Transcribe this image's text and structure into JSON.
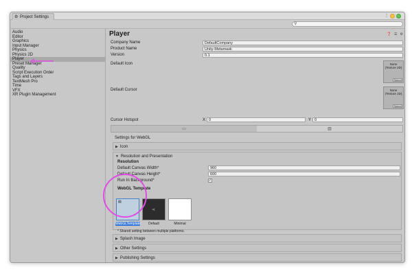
{
  "window": {
    "tab_title": "Project Settings",
    "search_placeholder": ""
  },
  "sidebar": {
    "items": [
      {
        "label": "Audio"
      },
      {
        "label": "Editor"
      },
      {
        "label": "Graphics"
      },
      {
        "label": "Input Manager"
      },
      {
        "label": "Physics"
      },
      {
        "label": "Physics 2D"
      },
      {
        "label": "Player"
      },
      {
        "label": "Preset Manager"
      },
      {
        "label": "Quality"
      },
      {
        "label": "Script Execution Order"
      },
      {
        "label": "Tags and Layers"
      },
      {
        "label": "TextMesh Pro"
      },
      {
        "label": "Time"
      },
      {
        "label": "VFX"
      },
      {
        "label": "XR Plugin Management"
      }
    ],
    "selected": "Player"
  },
  "main": {
    "title": "Player",
    "company_name_label": "Company Name",
    "company_name_value": "DefaultCompany",
    "product_name_label": "Product Name",
    "product_name_value": "Unity-Metamask",
    "version_label": "Version",
    "version_value": "0.1",
    "default_icon_label": "Default Icon",
    "default_cursor_label": "Default Cursor",
    "object_slot_text": "None\n(Texture 2D)",
    "select_label": "Select",
    "cursor_hotspot_label": "Cursor Hotspot",
    "hotspot_x_label": "X",
    "hotspot_x_value": "0",
    "hotspot_y_label": "Y",
    "hotspot_y_value": "0",
    "settings_for": "Settings for WebGL",
    "icon_foldout": "Icon",
    "resolution_foldout": "Resolution and Presentation",
    "resolution_subhead": "Resolution",
    "canvas_width_label": "Default Canvas Width*",
    "canvas_width_value": "960",
    "canvas_height_label": "Default Canvas Height*",
    "canvas_height_value": "600",
    "run_in_background_label": "Run In Background*",
    "run_in_background_checked": "✓",
    "webgl_template_label": "WebGL Template",
    "templates": [
      {
        "label": "WebGLTemplate"
      },
      {
        "label": "Default"
      },
      {
        "label": "Minimal"
      }
    ],
    "shared_note": "* Shared setting between multiple platforms.",
    "splash_foldout": "Splash Image",
    "other_foldout": "Other Settings",
    "publishing_foldout": "Publishing Settings"
  },
  "colors": {
    "annotation": "#e04ce3",
    "selection": "#3a7ad9"
  }
}
